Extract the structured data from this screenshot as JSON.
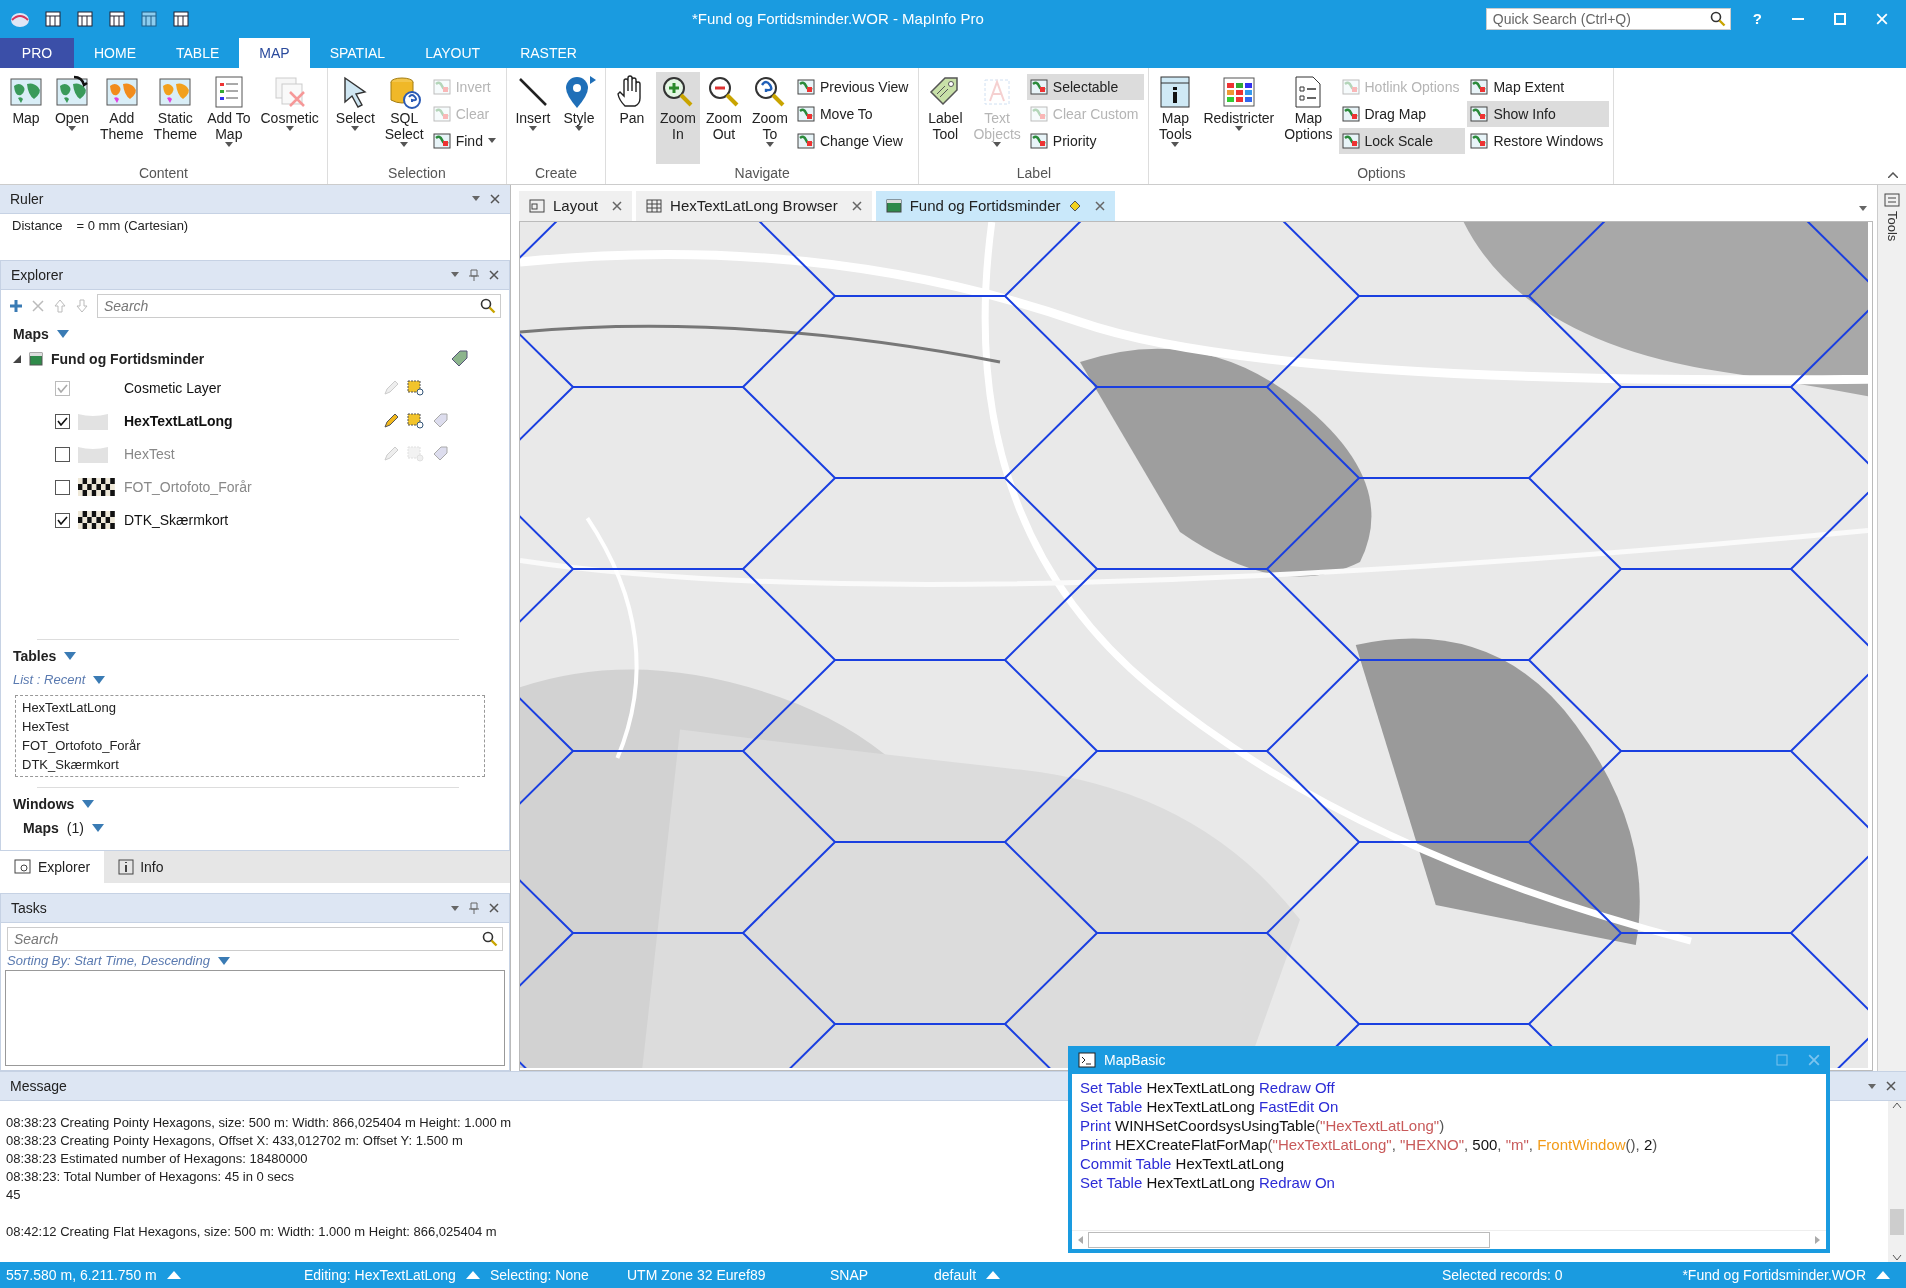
{
  "window": {
    "title": "*Fund og Fortidsminder.WOR - MapInfo Pro",
    "quick_search": {
      "placeholder": "Quick Search (Ctrl+Q)"
    },
    "help": "?"
  },
  "ribbon_tabs": [
    {
      "label": "PRO",
      "kind": "backstage",
      "selected": false
    },
    {
      "label": "HOME",
      "kind": "tab",
      "selected": false
    },
    {
      "label": "TABLE",
      "kind": "tab",
      "selected": false
    },
    {
      "label": "MAP",
      "kind": "tab",
      "selected": true
    },
    {
      "label": "SPATIAL",
      "kind": "tab",
      "selected": false
    },
    {
      "label": "LAYOUT",
      "kind": "tab",
      "selected": false
    },
    {
      "label": "RASTER",
      "kind": "tab",
      "selected": false
    }
  ],
  "ribbon_groups": [
    {
      "label": "Content",
      "items": [
        {
          "kind": "large",
          "label": "Map",
          "dropdown": false,
          "disabled": false,
          "selected": false
        },
        {
          "kind": "large",
          "label": "Open",
          "dropdown": true,
          "disabled": false,
          "selected": false
        },
        {
          "kind": "large",
          "label": "Add\nTheme",
          "dropdown": false,
          "disabled": false,
          "selected": false
        },
        {
          "kind": "large",
          "label": "Static\nTheme",
          "dropdown": false,
          "disabled": false,
          "selected": false
        },
        {
          "kind": "large",
          "label": "Add To\nMap",
          "dropdown": true,
          "disabled": false,
          "selected": false
        },
        {
          "kind": "large",
          "label": "Cosmetic",
          "dropdown": true,
          "disabled": false,
          "selected": false
        }
      ]
    },
    {
      "label": "Selection",
      "items": [
        {
          "kind": "large",
          "label": "Select",
          "dropdown": true,
          "disabled": false,
          "selected": false
        },
        {
          "kind": "large",
          "label": "SQL\nSelect",
          "dropdown": true,
          "disabled": false,
          "selected": false
        },
        {
          "kind": "stack",
          "buttons": [
            {
              "label": "Invert",
              "dropdown": false,
              "disabled": true,
              "selected": false
            },
            {
              "label": "Clear",
              "dropdown": false,
              "disabled": true,
              "selected": false
            },
            {
              "label": "Find",
              "dropdown": true,
              "disabled": false,
              "selected": false
            }
          ]
        }
      ]
    },
    {
      "label": "Create",
      "items": [
        {
          "kind": "large",
          "label": "Insert",
          "dropdown": true,
          "disabled": false,
          "selected": false
        },
        {
          "kind": "large",
          "label": "Style",
          "dropdown": true,
          "disabled": false,
          "selected": false
        }
      ]
    },
    {
      "label": "Navigate",
      "items": [
        {
          "kind": "large",
          "label": "Pan",
          "dropdown": false,
          "disabled": false,
          "selected": false
        },
        {
          "kind": "large",
          "label": "Zoom\nIn",
          "dropdown": false,
          "disabled": false,
          "selected": true
        },
        {
          "kind": "large",
          "label": "Zoom\nOut",
          "dropdown": false,
          "disabled": false,
          "selected": false
        },
        {
          "kind": "large",
          "label": "Zoom\nTo",
          "dropdown": true,
          "disabled": false,
          "selected": false
        },
        {
          "kind": "stack",
          "buttons": [
            {
              "label": "Previous View",
              "dropdown": false,
              "disabled": false,
              "selected": false
            },
            {
              "label": "Move To",
              "dropdown": false,
              "disabled": false,
              "selected": false
            },
            {
              "label": "Change View",
              "dropdown": false,
              "disabled": false,
              "selected": false
            }
          ]
        }
      ]
    },
    {
      "label": "Label",
      "items": [
        {
          "kind": "large",
          "label": "Label\nTool",
          "dropdown": false,
          "disabled": false,
          "selected": false
        },
        {
          "kind": "large",
          "label": "Text\nObjects",
          "dropdown": true,
          "disabled": true,
          "selected": false
        },
        {
          "kind": "stack",
          "buttons": [
            {
              "label": "Selectable",
              "dropdown": false,
              "disabled": false,
              "selected": true
            },
            {
              "label": "Clear Custom",
              "dropdown": false,
              "disabled": true,
              "selected": false
            },
            {
              "label": "Priority",
              "dropdown": false,
              "disabled": false,
              "selected": false
            }
          ]
        }
      ]
    },
    {
      "label": "Options",
      "items": [
        {
          "kind": "large",
          "label": "Map\nTools",
          "dropdown": true,
          "disabled": false,
          "selected": false
        },
        {
          "kind": "large",
          "label": "Redistricter",
          "dropdown": true,
          "disabled": false,
          "selected": false
        },
        {
          "kind": "large",
          "label": "Map\nOptions",
          "dropdown": false,
          "disabled": false,
          "selected": false
        },
        {
          "kind": "stack",
          "buttons": [
            {
              "label": "Hotlink Options",
              "dropdown": false,
              "disabled": true,
              "selected": false
            },
            {
              "label": "Drag Map",
              "dropdown": false,
              "disabled": false,
              "selected": false
            },
            {
              "label": "Lock Scale",
              "dropdown": false,
              "disabled": false,
              "selected": true
            }
          ]
        },
        {
          "kind": "stack",
          "buttons": [
            {
              "label": "Map Extent",
              "dropdown": false,
              "disabled": false,
              "selected": false
            },
            {
              "label": "Show Info",
              "dropdown": false,
              "disabled": false,
              "selected": true
            },
            {
              "label": "Restore Windows",
              "dropdown": false,
              "disabled": false,
              "selected": false
            }
          ]
        }
      ]
    }
  ],
  "ruler": {
    "title": "Ruler",
    "rows": [
      {
        "label": "Distance",
        "value": "= 0 mm (Cartesian)"
      }
    ]
  },
  "explorer": {
    "title": "Explorer",
    "search": {
      "placeholder": "Search"
    },
    "maps_heading": "Maps",
    "map": {
      "name": "Fund og Fortidsminder",
      "expanded": true,
      "layers": [
        {
          "name": "Cosmetic Layer",
          "kind": "cosmetic",
          "checked": true,
          "disabled": true,
          "editable": false,
          "selectable": true
        },
        {
          "name": "HexTextLatLong",
          "kind": "vector",
          "checked": true,
          "disabled": false,
          "editable": true,
          "selectable": true
        },
        {
          "name": "HexTest",
          "kind": "vector",
          "checked": false,
          "disabled": false,
          "editable": false,
          "selectable": false
        },
        {
          "name": "FOT_Ortofoto_Forår",
          "kind": "raster",
          "checked": false,
          "disabled": false,
          "editable": false
        },
        {
          "name": "DTK_Skærmkort",
          "kind": "raster",
          "checked": true,
          "disabled": false,
          "editable": false
        }
      ]
    },
    "tables_heading": "Tables",
    "list_mode": "List : Recent",
    "tables": [
      "HexTextLatLong",
      "HexTest",
      "FOT_Ortofoto_Forår",
      "DTK_Skærmkort"
    ],
    "windows_heading": "Windows",
    "windows_group": {
      "label": "Maps",
      "count": "(1)"
    }
  },
  "panel_tabs": [
    {
      "label": "Explorer",
      "selected": true
    },
    {
      "label": "Info",
      "selected": false
    }
  ],
  "tasks": {
    "title": "Tasks",
    "search": {
      "placeholder": "Search"
    },
    "sorting": "Sorting By: Start Time, Descending"
  },
  "document_tabs": [
    {
      "label": "Layout",
      "kind": "layout",
      "selected": false,
      "modified": false
    },
    {
      "label": "HexTextLatLong Browser",
      "kind": "browser",
      "selected": false,
      "modified": false
    },
    {
      "label": "Fund og Fortidsminder",
      "kind": "map",
      "selected": true,
      "modified": true
    }
  ],
  "side_strip": {
    "label": "Tools"
  },
  "message": {
    "title": "Message",
    "entries": [
      {
        "lines": [
          "08:38:23 Creating Pointy Hexagons, size: 500 m: Width: 866,025404 m Height: 1.000 m",
          "08:38:23 Creating Pointy Hexagons, Offset X: 433,012702 m: Offset Y: 1.500 m",
          "08:38:23 Estimated number of Hexagons: 18480000",
          "08:38:23: Total Number of Hexagons: 45 in 0 secs",
          "45"
        ]
      },
      {
        "lines": [
          "08:42:12 Creating Flat Hexagons, size: 500 m: Width: 1.000 m Height: 866,025404 m"
        ]
      }
    ]
  },
  "mapbasic": {
    "title": "MapBasic",
    "lines": [
      [
        {
          "kind": "keyword",
          "text": "Set Table "
        },
        {
          "kind": "plain",
          "text": "HexTextLatLong "
        },
        {
          "kind": "keyword",
          "text": "Redraw Off"
        }
      ],
      [
        {
          "kind": "keyword",
          "text": "Set Table "
        },
        {
          "kind": "plain",
          "text": "HexTextLatLong "
        },
        {
          "kind": "keyword",
          "text": "FastEdit On"
        }
      ],
      [
        {
          "kind": "keyword",
          "text": "Print "
        },
        {
          "kind": "plain",
          "text": "WINHSetCoordsysUsingTable"
        },
        {
          "kind": "punct",
          "text": "("
        },
        {
          "kind": "string",
          "text": "\"HexTextLatLong\""
        },
        {
          "kind": "punct",
          "text": ")"
        }
      ],
      [
        {
          "kind": "keyword",
          "text": "Print "
        },
        {
          "kind": "plain",
          "text": "HEXCreateFlatForMap"
        },
        {
          "kind": "punct",
          "text": "("
        },
        {
          "kind": "string",
          "text": "\"HexTextLatLong\""
        },
        {
          "kind": "punct",
          "text": ", "
        },
        {
          "kind": "string",
          "text": "\"HEXNO\""
        },
        {
          "kind": "punct",
          "text": ", "
        },
        {
          "kind": "plain",
          "text": "500"
        },
        {
          "kind": "punct",
          "text": ", "
        },
        {
          "kind": "string",
          "text": "\"m\""
        },
        {
          "kind": "punct",
          "text": ", "
        },
        {
          "kind": "function",
          "text": "FrontWindow"
        },
        {
          "kind": "punct",
          "text": "(), "
        },
        {
          "kind": "plain",
          "text": "2"
        },
        {
          "kind": "punct",
          "text": ")"
        }
      ],
      [
        {
          "kind": "keyword",
          "text": "Commit Table "
        },
        {
          "kind": "plain",
          "text": "HexTextLatLong"
        }
      ],
      [
        {
          "kind": "keyword",
          "text": "Set Table "
        },
        {
          "kind": "plain",
          "text": "HexTextLatLong "
        },
        {
          "kind": "keyword",
          "text": "Redraw On"
        }
      ]
    ]
  },
  "status_bar": [
    {
      "text": "557.580 m, 6.211.750 m",
      "menu": true
    },
    {
      "text": "Editing: HexTextLatLong",
      "menu": true
    },
    {
      "text": "Selecting: None",
      "menu": false
    },
    {
      "text": "UTM Zone 32 Euref89",
      "menu": false
    },
    {
      "text": "SNAP",
      "menu": false
    },
    {
      "text": "default",
      "menu": true
    },
    {
      "text": "Selected records: 0",
      "menu": false
    },
    {
      "text": "*Fund og Fortidsminder.WOR",
      "menu": true
    }
  ]
}
